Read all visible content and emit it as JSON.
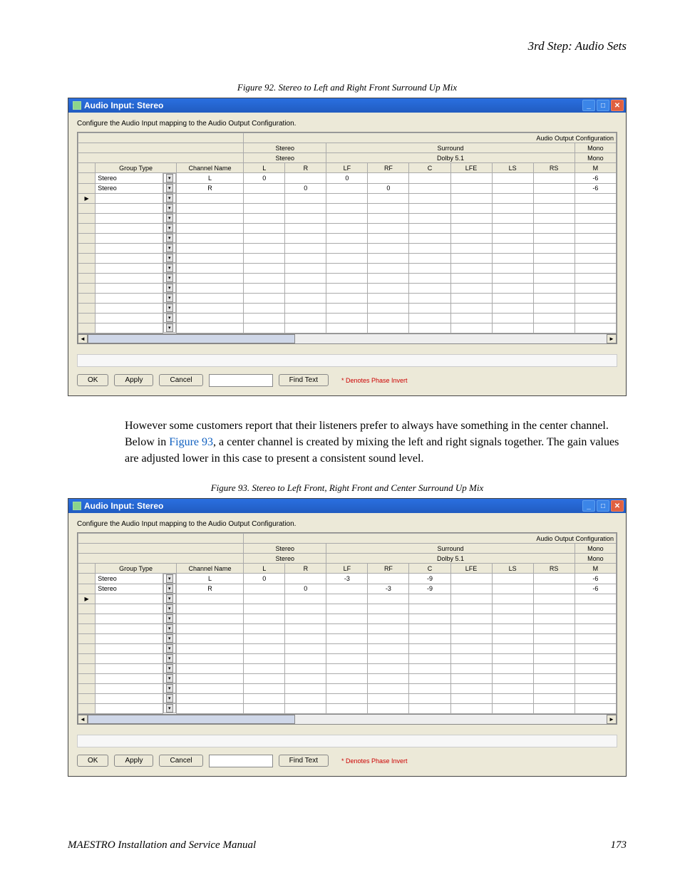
{
  "header": {
    "title": "3rd Step: Audio Sets"
  },
  "figure92": {
    "caption": "Figure 92.  Stereo to Left and Right Front Surround Up Mix",
    "window": {
      "title": "Audio Input: Stereo",
      "instruction": "Configure the Audio Input mapping to the Audio Output Configuration.",
      "topRightLabel": "Audio Output Configuration",
      "groupHeaders": {
        "stereo": "Stereo",
        "surround": "Surround",
        "mono": "Mono",
        "stereoSub": "Stereo",
        "dolby": "Dolby 5.1",
        "monoSub": "Mono"
      },
      "columns": {
        "groupType": "Group Type",
        "channelName": "Channel Name",
        "L": "L",
        "R": "R",
        "LF": "LF",
        "RF": "RF",
        "C": "C",
        "LFE": "LFE",
        "LS": "LS",
        "RS": "RS",
        "M": "M"
      },
      "rows": [
        {
          "groupType": "Stereo",
          "channelName": "L",
          "L": "0",
          "R": "",
          "LF": "0",
          "RF": "",
          "C": "",
          "LFE": "",
          "LS": "",
          "RS": "",
          "M": "-6"
        },
        {
          "groupType": "Stereo",
          "channelName": "R",
          "L": "",
          "R": "0",
          "LF": "",
          "RF": "0",
          "C": "",
          "LFE": "",
          "LS": "",
          "RS": "",
          "M": "-6"
        }
      ],
      "emptyRows": 14,
      "buttons": {
        "ok": "OK",
        "apply": "Apply",
        "cancel": "Cancel",
        "findText": "Find Text"
      },
      "phaseNote": "* Denotes Phase Invert"
    }
  },
  "bodyText": {
    "p1a": "However some customers report that their listeners prefer to always have something in the center channel. Below in ",
    "p1link": "Figure 93",
    "p1b": ", a center channel is created by mixing the left and right signals together. The gain values are adjusted lower in this case to present a consistent sound level."
  },
  "figure93": {
    "caption": "Figure 93.  Stereo to Left Front, Right Front and Center Surround Up Mix",
    "window": {
      "title": "Audio Input: Stereo",
      "instruction": "Configure the Audio Input mapping to the Audio Output Configuration.",
      "topRightLabel": "Audio Output Configuration",
      "groupHeaders": {
        "stereo": "Stereo",
        "surround": "Surround",
        "mono": "Mono",
        "stereoSub": "Stereo",
        "dolby": "Dolby 5.1",
        "monoSub": "Mono"
      },
      "columns": {
        "groupType": "Group Type",
        "channelName": "Channel Name",
        "L": "L",
        "R": "R",
        "LF": "LF",
        "RF": "RF",
        "C": "C",
        "LFE": "LFE",
        "LS": "LS",
        "RS": "RS",
        "M": "M"
      },
      "rows": [
        {
          "groupType": "Stereo",
          "channelName": "L",
          "L": "0",
          "R": "",
          "LF": "-3",
          "RF": "",
          "C": "-9",
          "LFE": "",
          "LS": "",
          "RS": "",
          "M": "-6"
        },
        {
          "groupType": "Stereo",
          "channelName": "R",
          "L": "",
          "R": "0",
          "LF": "",
          "RF": "-3",
          "C": "-9",
          "LFE": "",
          "LS": "",
          "RS": "",
          "M": "-6"
        }
      ],
      "emptyRows": 12,
      "buttons": {
        "ok": "OK",
        "apply": "Apply",
        "cancel": "Cancel",
        "findText": "Find Text"
      },
      "phaseNote": "* Denotes Phase Invert"
    }
  },
  "footer": {
    "left": "MAESTRO Installation and Service Manual",
    "right": "173"
  },
  "chart_data": [
    {
      "type": "table",
      "title": "Stereo to Left and Right Front Surround Up Mix",
      "columns": [
        "Group Type",
        "Channel Name",
        "L",
        "R",
        "LF",
        "RF",
        "C",
        "LFE",
        "LS",
        "RS",
        "M"
      ],
      "rows": [
        [
          "Stereo",
          "L",
          "0",
          "",
          "0",
          "",
          "",
          "",
          "",
          "",
          "-6"
        ],
        [
          "Stereo",
          "R",
          "",
          "0",
          "",
          "0",
          "",
          "",
          "",
          "",
          "-6"
        ]
      ]
    },
    {
      "type": "table",
      "title": "Stereo to Left Front, Right Front and Center Surround Up Mix",
      "columns": [
        "Group Type",
        "Channel Name",
        "L",
        "R",
        "LF",
        "RF",
        "C",
        "LFE",
        "LS",
        "RS",
        "M"
      ],
      "rows": [
        [
          "Stereo",
          "L",
          "0",
          "",
          "-3",
          "",
          "-9",
          "",
          "",
          "",
          "-6"
        ],
        [
          "Stereo",
          "R",
          "",
          "0",
          "",
          "-3",
          "-9",
          "",
          "",
          "",
          "-6"
        ]
      ]
    }
  ]
}
